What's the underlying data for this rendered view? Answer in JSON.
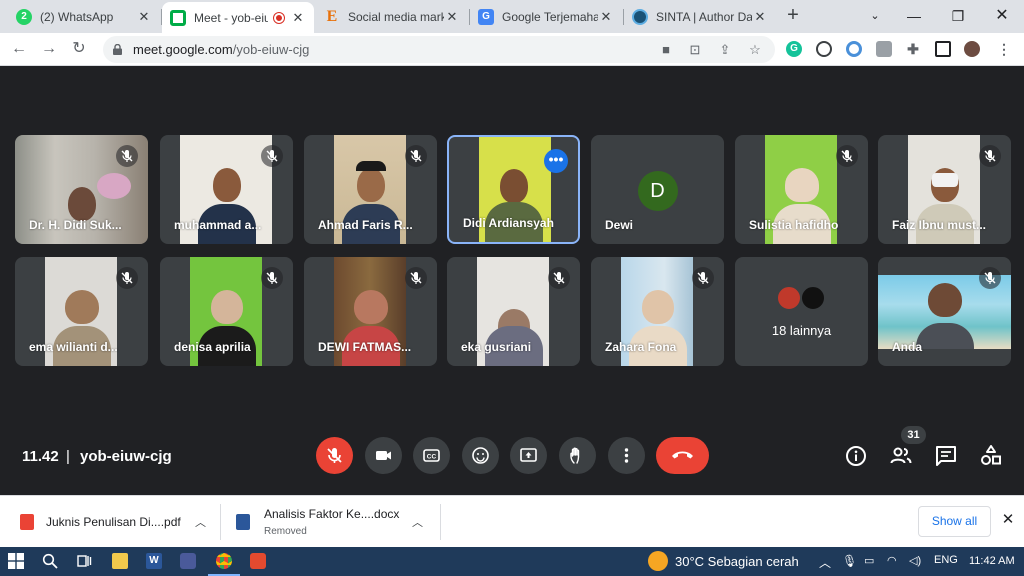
{
  "tabs": [
    {
      "title": "(2) WhatsApp",
      "icon": "whatsapp-icon",
      "active": false
    },
    {
      "title": "Meet - yob-eiuw",
      "icon": "google-meet-icon",
      "active": true
    },
    {
      "title": "Social media mark",
      "icon": "e-letter-icon",
      "active": false
    },
    {
      "title": "Google Terjemahan",
      "icon": "google-translate-icon",
      "active": false
    },
    {
      "title": "SINTA | Author Da",
      "icon": "sinta-icon",
      "active": false
    }
  ],
  "address": {
    "domain": "meet.google.com",
    "path": "/yob-eiuw-cjg"
  },
  "participants": [
    {
      "name": "Dr. H. Didi Suk...",
      "muted": true
    },
    {
      "name": "muhammad a...",
      "muted": true
    },
    {
      "name": "Ahmad Faris R...",
      "muted": true
    },
    {
      "name": "Didi Ardiansyah",
      "muted": false,
      "speaking": true
    },
    {
      "name": "Dewi",
      "muted": false,
      "avatar_letter": "D"
    },
    {
      "name": "Sulistia hafidho",
      "muted": true
    },
    {
      "name": "Faiz Ibnu must...",
      "muted": true
    },
    {
      "name": "ema wilianti d...",
      "muted": true
    },
    {
      "name": "denisa aprilia",
      "muted": true
    },
    {
      "name": "DEWI FATMAS...",
      "muted": true
    },
    {
      "name": "eka gusriani",
      "muted": true
    },
    {
      "name": "Zahara Fona",
      "muted": true
    },
    {
      "name": "18 lainnya",
      "muted": false
    },
    {
      "name": "Anda",
      "muted": true
    }
  ],
  "meeting": {
    "time": "11.42",
    "separator": "|",
    "code": "yob-eiuw-cjg",
    "participant_count": "31"
  },
  "controls": [
    "mic-off-icon",
    "camera-icon",
    "captions-icon",
    "emoji-icon",
    "present-icon",
    "raise-hand-icon",
    "more-options-icon",
    "end-call-icon"
  ],
  "right_controls": [
    "info-icon",
    "people-icon",
    "chat-icon",
    "activities-icon"
  ],
  "downloads": [
    {
      "name": "Juknis Penulisan Di....pdf",
      "status": ""
    },
    {
      "name": "Analisis Faktor Ke....docx",
      "status": "Removed"
    }
  ],
  "download_bar": {
    "show_all": "Show all"
  },
  "taskbar": {
    "weather_temp": "30°C",
    "weather_text": "Sebagian cerah",
    "language": "ENG",
    "time": "11:42 AM"
  },
  "colors": {
    "meet_bg": "#202124",
    "tile_bg": "#3c4043",
    "red": "#ea4335",
    "focus": "#8ab4f8",
    "link": "#1a73e8"
  }
}
